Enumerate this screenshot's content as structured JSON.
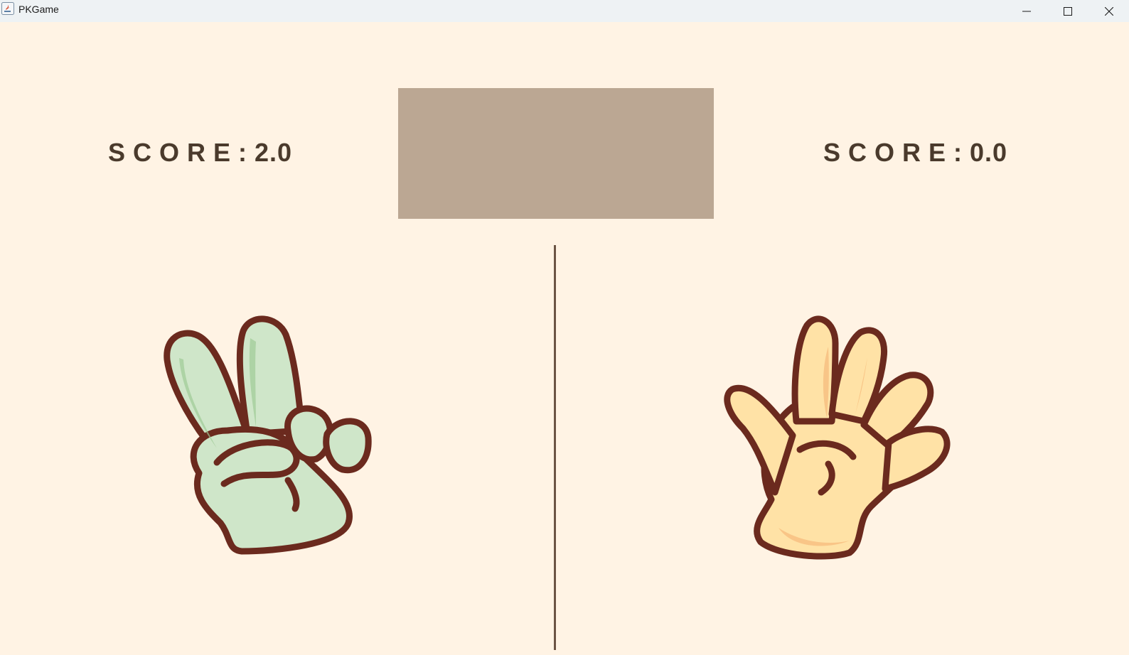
{
  "window": {
    "title": "PKGame",
    "icons": {
      "app": "java-app-icon",
      "minimize": "minimize-icon",
      "maximize": "maximize-icon",
      "close": "close-icon"
    }
  },
  "game": {
    "player_score": {
      "label": "SCORE:",
      "value": "2.0"
    },
    "opponent_score": {
      "label": "SCORE:",
      "value": "0.0"
    },
    "result_panel_text": "",
    "player_hand": {
      "gesture": "scissors",
      "icon": "peace-sign-hand-icon",
      "color": "#cfe6c9"
    },
    "opponent_hand": {
      "gesture": "paper",
      "icon": "open-palm-hand-icon",
      "color": "#ffe2a6"
    }
  },
  "colors": {
    "background": "#fff3e4",
    "result_panel": "#bba793",
    "score_text": "#4a3a2c",
    "divider": "#6b5444",
    "hand_outline": "#6b2a1e"
  }
}
